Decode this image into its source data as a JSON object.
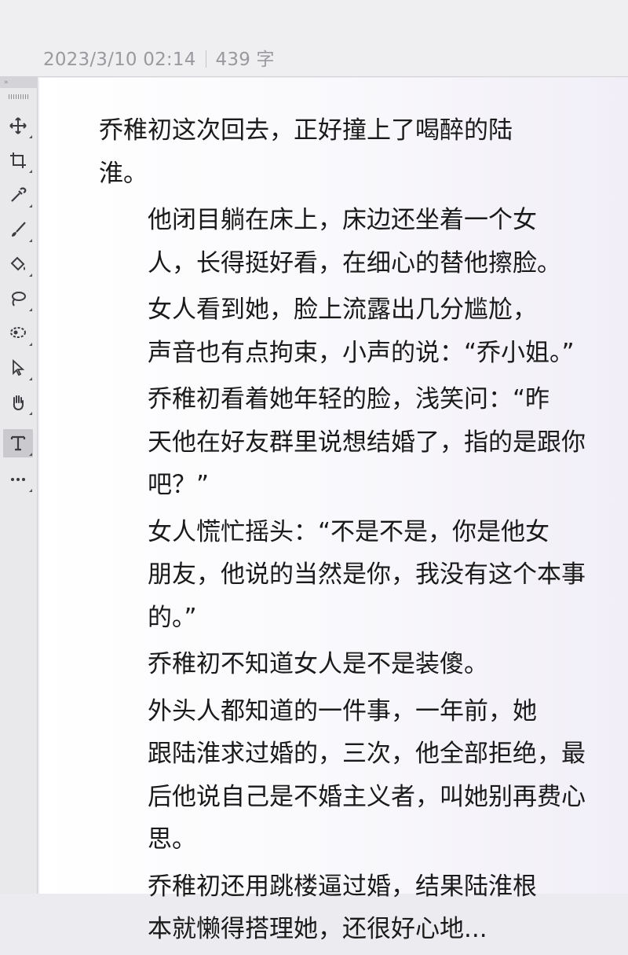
{
  "header": {
    "date": "2023/3/10 02:14",
    "word_count": "439 字"
  },
  "toolbar": {
    "tools": [
      {
        "name": "move-tool",
        "glyph": "✥"
      },
      {
        "name": "crop-tool",
        "glyph": "⌗"
      },
      {
        "name": "eyedropper-tool",
        "glyph": "✎"
      },
      {
        "name": "brush-tool",
        "glyph": "⁄"
      },
      {
        "name": "paint-bucket-tool",
        "glyph": "⛾"
      },
      {
        "name": "lasso-tool",
        "glyph": "ℓ"
      },
      {
        "name": "selection-tool",
        "glyph": "◌"
      },
      {
        "name": "pointer-tool",
        "glyph": "↖"
      },
      {
        "name": "hand-tool",
        "glyph": "✋"
      },
      {
        "name": "text-tool",
        "glyph": "T"
      },
      {
        "name": "more-tools",
        "glyph": "•••"
      }
    ]
  },
  "document": {
    "paragraphs": [
      {
        "lines": [
          "乔稚初这次回去，正好撞上了喝醉的陆",
          "淮。"
        ]
      },
      {
        "lines": [
          "他闭目躺在床上，床边还坐着一个女",
          "人，长得挺好看，在细心的替他擦脸。"
        ]
      },
      {
        "lines": [
          "女人看到她，脸上流露出几分尴尬，",
          "声音也有点拘束，小声的说：“乔小姐。”"
        ]
      },
      {
        "lines": [
          "乔稚初看着她年轻的脸，浅笑问：“昨",
          "天他在好友群里说想结婚了，指的是跟你",
          "吧？”"
        ]
      },
      {
        "lines": [
          "女人慌忙摇头：“不是不是，你是他女",
          "朋友，他说的当然是你，我没有这个本事",
          "的。”"
        ]
      },
      {
        "lines": [
          "乔稚初不知道女人是不是装傻。"
        ]
      },
      {
        "lines": [
          "外头人都知道的一件事，一年前，她",
          "跟陆淮求过婚的，三次，他全部拒绝，最",
          "后他说自己是不婚主义者，叫她别再费心",
          "思。"
        ]
      },
      {
        "lines": [
          "乔稚初还用跳楼逼过婚，结果陆淮根",
          "本就懒得搭理她，还很好心地..."
        ]
      }
    ]
  }
}
